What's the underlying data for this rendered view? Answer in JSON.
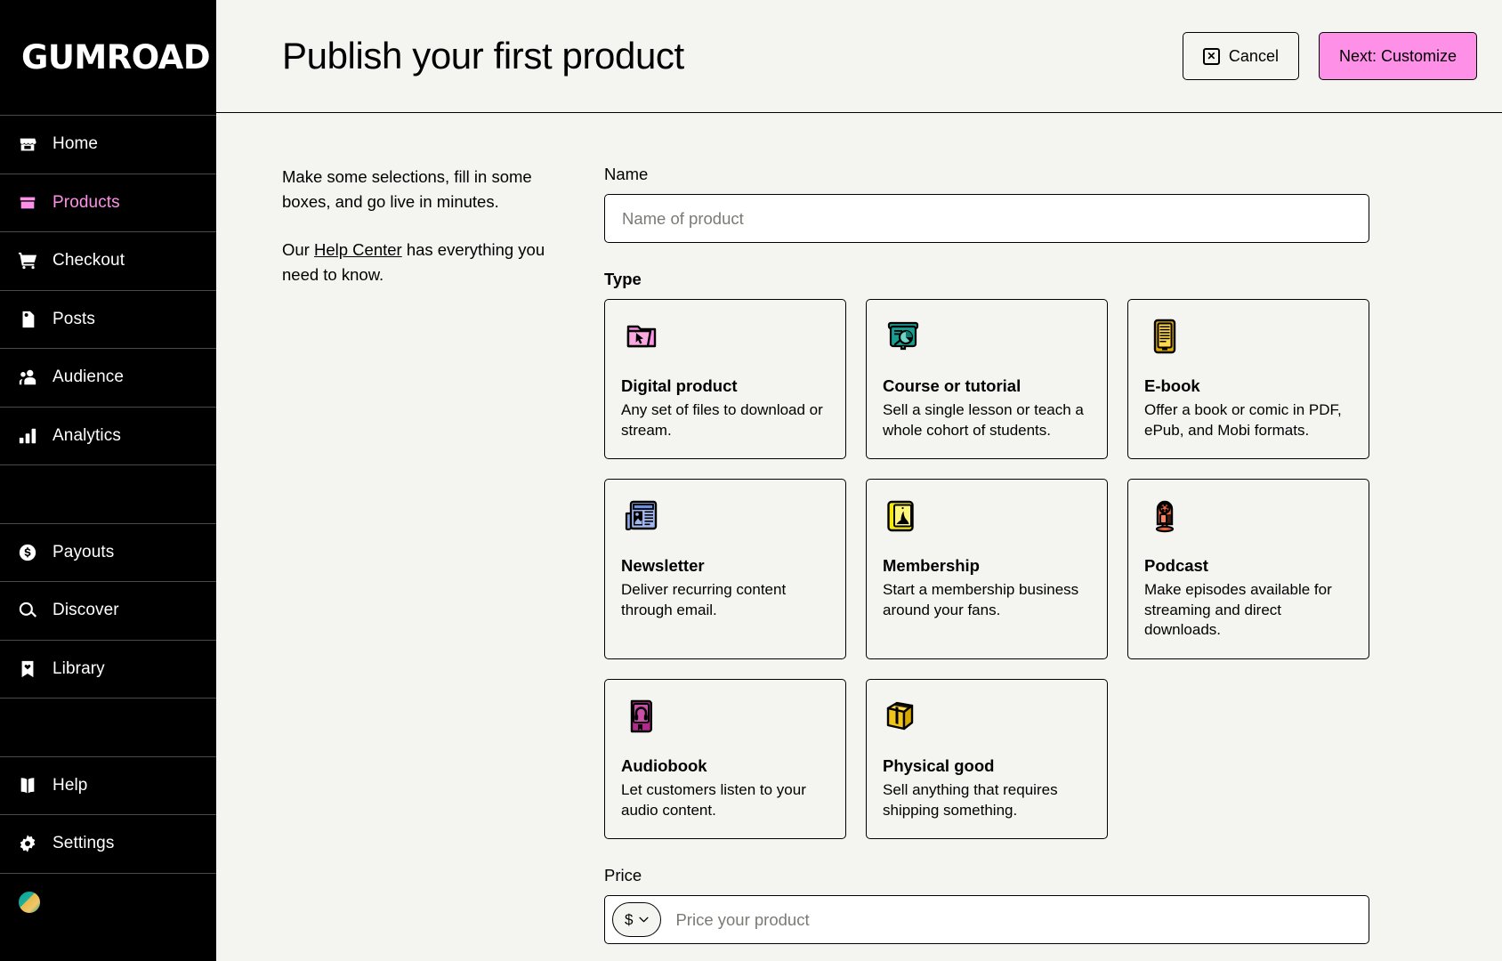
{
  "brand": {
    "name": "GUMROAD"
  },
  "sidebar": {
    "items": [
      {
        "label": "Home",
        "icon": "store-icon",
        "active": false
      },
      {
        "label": "Products",
        "icon": "products-box-icon",
        "active": true
      },
      {
        "label": "Checkout",
        "icon": "shopping-cart-icon",
        "active": false
      },
      {
        "label": "Posts",
        "icon": "document-icon",
        "active": false
      },
      {
        "label": "Audience",
        "icon": "people-icon",
        "active": false
      },
      {
        "label": "Payouts",
        "icon": "dollar-circle-icon",
        "active": false
      },
      {
        "label": "Discover",
        "icon": "search-icon",
        "active": false
      },
      {
        "label": "Library",
        "icon": "bookmark-heart-icon",
        "active": false
      },
      {
        "label": "Help",
        "icon": "book-icon",
        "active": false
      },
      {
        "label": "Settings",
        "icon": "gear-icon",
        "active": false
      }
    ]
  },
  "header": {
    "title": "Publish your first product",
    "cancel_label": "Cancel",
    "next_label": "Next: Customize"
  },
  "intro": {
    "paragraph1": "Make some selections, fill in some boxes, and go live in minutes.",
    "p2_before": "Our ",
    "p2_link": "Help Center",
    "p2_after": " has everything you need to know."
  },
  "form": {
    "name_label": "Name",
    "name_value": "",
    "name_placeholder": "Name of product",
    "type_label": "Type",
    "price_label": "Price",
    "price_value": "",
    "price_placeholder": "Price your product",
    "currency_symbol": "$"
  },
  "types": [
    {
      "title": "Digital product",
      "desc": "Any set of files to download or stream.",
      "icon": "folder-cursor-icon"
    },
    {
      "title": "Course or tutorial",
      "desc": "Sell a single lesson or teach a whole cohort of students.",
      "icon": "presentation-chart-icon"
    },
    {
      "title": "E-book",
      "desc": "Offer a book or comic in PDF, ePub, and Mobi formats.",
      "icon": "ebook-icon"
    },
    {
      "title": "Newsletter",
      "desc": "Deliver recurring content through email.",
      "icon": "newspaper-icon"
    },
    {
      "title": "Membership",
      "desc": "Start a membership business around your fans.",
      "icon": "membership-card-icon"
    },
    {
      "title": "Podcast",
      "desc": "Make episodes available for streaming and direct downloads.",
      "icon": "microphone-icon"
    },
    {
      "title": "Audiobook",
      "desc": "Let customers listen to your audio content.",
      "icon": "audiobook-headphones-icon"
    },
    {
      "title": "Physical good",
      "desc": "Sell anything that requires shipping something.",
      "icon": "shipping-box-icon"
    }
  ],
  "colors": {
    "accent_pink": "#ff90e8",
    "sidebar_bg": "#000000",
    "page_bg": "#f4f4f0",
    "icon_teal": "#1a9e91",
    "icon_yellow": "#f0c419",
    "icon_blue": "#8fa8e8",
    "icon_orange": "#f4663f",
    "icon_magenta": "#b5298f"
  }
}
